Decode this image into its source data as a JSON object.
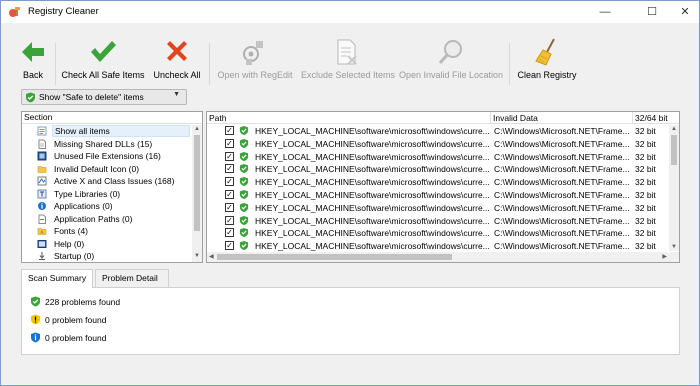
{
  "window": {
    "title": "Registry Cleaner",
    "icon": "registry-cleaner-app-icon",
    "controls": [
      "minimize-icon",
      "maximize-icon",
      "close-icon"
    ]
  },
  "toolbar": {
    "back_label": "Back",
    "check_all_label": "Check All Safe Items",
    "uncheck_all_label": "Uncheck All",
    "open_regedit_label": "Open with RegEdit",
    "exclude_label": "Exclude Selected Items",
    "open_location_label": "Open Invalid File Location",
    "clean_label": "Clean Registry"
  },
  "filter": {
    "selected": "Show \"Safe to delete\" items"
  },
  "sections": {
    "header": "Section",
    "items": [
      {
        "label": "Show all items",
        "icon": "list-icon"
      },
      {
        "label": "Missing Shared DLLs (15)",
        "icon": "dll-file-icon"
      },
      {
        "label": "Unused File Extensions (16)",
        "icon": "extension-icon"
      },
      {
        "label": "Invalid Default Icon (0)",
        "icon": "folder-icon"
      },
      {
        "label": "Active X and Class Issues (168)",
        "icon": "activex-icon"
      },
      {
        "label": "Type Libraries (0)",
        "icon": "type-library-icon"
      },
      {
        "label": "Applications (0)",
        "icon": "application-icon"
      },
      {
        "label": "Application Paths (0)",
        "icon": "app-path-icon"
      },
      {
        "label": "Fonts (4)",
        "icon": "font-folder-icon"
      },
      {
        "label": "Help (0)",
        "icon": "help-icon"
      },
      {
        "label": "Startup (0)",
        "icon": "startup-icon"
      }
    ]
  },
  "results": {
    "columns": {
      "path": "Path",
      "data": "Invalid Data",
      "bits": "32/64 bit"
    },
    "rows": [
      {
        "path": "HKEY_LOCAL_MACHINE\\software\\microsoft\\windows\\curre...",
        "data": "C:\\Windows\\Microsoft.NET\\Frame...",
        "bits": "32 bit"
      },
      {
        "path": "HKEY_LOCAL_MACHINE\\software\\microsoft\\windows\\curre...",
        "data": "C:\\Windows\\Microsoft.NET\\Frame...",
        "bits": "32 bit"
      },
      {
        "path": "HKEY_LOCAL_MACHINE\\software\\microsoft\\windows\\curre...",
        "data": "C:\\Windows\\Microsoft.NET\\Frame...",
        "bits": "32 bit"
      },
      {
        "path": "HKEY_LOCAL_MACHINE\\software\\microsoft\\windows\\curre...",
        "data": "C:\\Windows\\Microsoft.NET\\Frame...",
        "bits": "32 bit"
      },
      {
        "path": "HKEY_LOCAL_MACHINE\\software\\microsoft\\windows\\curre...",
        "data": "C:\\Windows\\Microsoft.NET\\Frame...",
        "bits": "32 bit"
      },
      {
        "path": "HKEY_LOCAL_MACHINE\\software\\microsoft\\windows\\curre...",
        "data": "C:\\Windows\\Microsoft.NET\\Frame...",
        "bits": "32 bit"
      },
      {
        "path": "HKEY_LOCAL_MACHINE\\software\\microsoft\\windows\\curre...",
        "data": "C:\\Windows\\Microsoft.NET\\Frame...",
        "bits": "32 bit"
      },
      {
        "path": "HKEY_LOCAL_MACHINE\\software\\microsoft\\windows\\curre...",
        "data": "C:\\Windows\\Microsoft.NET\\Frame...",
        "bits": "32 bit"
      },
      {
        "path": "HKEY_LOCAL_MACHINE\\software\\microsoft\\windows\\curre...",
        "data": "C:\\Windows\\Microsoft.NET\\Frame...",
        "bits": "32 bit"
      },
      {
        "path": "HKEY_LOCAL_MACHINE\\software\\microsoft\\windows\\curre...",
        "data": "C:\\Windows\\Microsoft.NET\\Frame...",
        "bits": "32 bit"
      }
    ]
  },
  "tabs": [
    {
      "label": "Scan Summary",
      "active": true
    },
    {
      "label": "Problem Detail",
      "active": false
    }
  ],
  "summary": [
    {
      "label": "228 problems found",
      "icon": "green-shield-check-icon"
    },
    {
      "label": "0 problem found",
      "icon": "yellow-shield-warning-icon"
    },
    {
      "label": "0 problem found",
      "icon": "blue-shield-info-icon"
    }
  ],
  "colors": {
    "accent_green": "#3aa33a",
    "cancel_red": "#e0461e",
    "selection": "#e5f0fb",
    "warning_yellow": "#f5c400",
    "info_blue": "#1a73c7"
  }
}
